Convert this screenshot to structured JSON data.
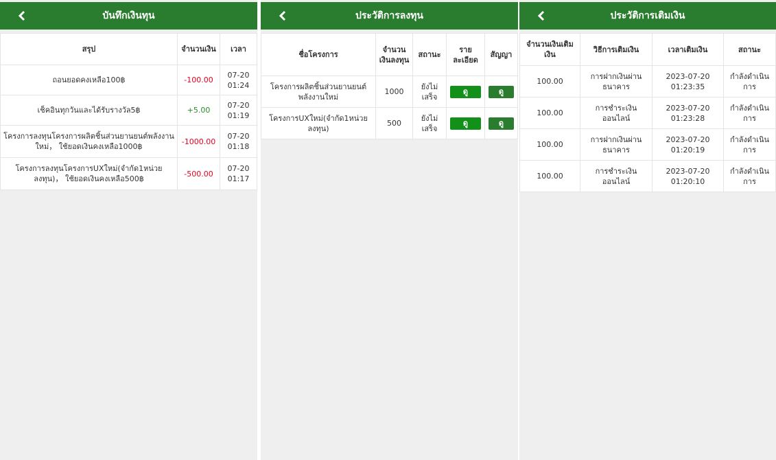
{
  "fund_record": {
    "title": "บันทึกเงินทุน",
    "headers": [
      "สรุป",
      "จำนวนเงิน",
      "เวลา"
    ],
    "rows": [
      {
        "summary": "ถอนยอดคงเหลือ100฿",
        "amount": "-100.00",
        "time": "07-20 01:24",
        "type": "neg"
      },
      {
        "summary": "เช็คอินทุกวันและได้รับรางวัล5฿",
        "amount": "+5.00",
        "time": "07-20 01:19",
        "type": "pos"
      },
      {
        "summary": "โครงการลงทุนโครงการผลิตชิ้นส่วนยานยนต์พลังงานใหม่， ใช้ยอดเงินคงเหลือ1000฿",
        "amount": "-1000.00",
        "time": "07-20 01:18",
        "type": "neg"
      },
      {
        "summary": "โครงการลงทุนโครงการUXใหม่(จำกัด1หน่วยลงทุน)， ใช้ยอดเงินคงเหลือ500฿",
        "amount": "-500.00",
        "time": "07-20 01:17",
        "type": "neg"
      }
    ]
  },
  "invest_history": {
    "title": "ประวัติการลงทุน",
    "headers": [
      "ชื่อโครงการ",
      "จำนวนเงินลงทุน",
      "สถานะ",
      "รายละเอียด",
      "สัญญา"
    ],
    "rows": [
      {
        "name": "โครงการผลิตชิ้นส่วนยานยนต์พลังงานใหม่",
        "amount": "1000",
        "status": "ยังไม่เสร็จ",
        "detail": "ดู",
        "contract": "ดู"
      },
      {
        "name": "โครงการUXใหม่(จำกัด1หน่วยลงทุน)",
        "amount": "500",
        "status": "ยังไม่เสร็จ",
        "detail": "ดู",
        "contract": "ดู"
      }
    ]
  },
  "topup_history": {
    "title": "ประวัติการเติมเงิน",
    "headers": [
      "จำนวนเงินเติมเงิน",
      "วิธีการเติมเงิน",
      "เวลาเติมเงิน",
      "สถานะ"
    ],
    "rows": [
      {
        "amount": "100.00",
        "method": "การฝากเงินผ่านธนาคาร",
        "time": "2023-07-20 01:23:35",
        "status": "กำลังดำเนินการ"
      },
      {
        "amount": "100.00",
        "method": "การชำระเงินออนไลน์",
        "time": "2023-07-20 01:23:28",
        "status": "กำลังดำเนินการ"
      },
      {
        "amount": "100.00",
        "method": "การฝากเงินผ่านธนาคาร",
        "time": "2023-07-20 01:20:19",
        "status": "กำลังดำเนินการ"
      },
      {
        "amount": "100.00",
        "method": "การชำระเงินออนไลน์",
        "time": "2023-07-20 01:20:10",
        "status": "กำลังดำเนินการ"
      }
    ]
  }
}
